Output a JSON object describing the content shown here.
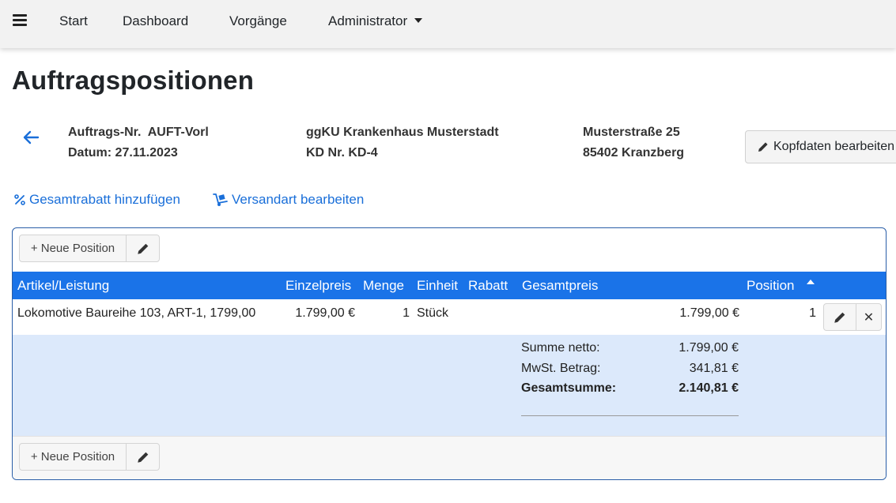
{
  "nav": {
    "items": [
      "Start",
      "Dashboard",
      "Vorgänge"
    ],
    "admin_label": "Administrator"
  },
  "page": {
    "title": "Auftragspositionen"
  },
  "header": {
    "order_no": "Auftrags-Nr.  AUFT-Vorl",
    "date": "Datum: 27.11.2023",
    "customer_name": "ggKU Krankenhaus Musterstadt",
    "customer_no": "KD Nr. KD-4",
    "street": "Musterstraße 25",
    "city": "85402 Kranzberg",
    "edit_button": "Kopfdaten bearbeiten"
  },
  "actions": {
    "discount": "Gesamtrabatt hinzufügen",
    "shipping": "Versandart bearbeiten"
  },
  "toolbar": {
    "new_position": "+ Neue Position"
  },
  "table": {
    "columns": {
      "article": "Artikel/Leistung",
      "unit_price": "Einzelpreis",
      "quantity": "Menge",
      "unit": "Einheit",
      "discount": "Rabatt",
      "total": "Gesamtpreis",
      "position": "Position"
    },
    "rows": [
      {
        "article": "Lokomotive Baureihe 103, ART-1, 1799,00",
        "unit_price": "1.799,00 €",
        "quantity": "1",
        "unit": "Stück",
        "discount": "",
        "total": "1.799,00 €",
        "position": "1"
      }
    ]
  },
  "summary": {
    "net_label": "Summe netto:",
    "net_value": "1.799,00 €",
    "vat_label": "MwSt. Betrag:",
    "vat_value": "341,81 €",
    "gross_label": "Gesamtsumme:",
    "gross_value": "2.140,81 €"
  },
  "colors": {
    "header_bg": "#1a73e8",
    "summary_bg": "#dce9fb",
    "link": "#1a6fd9",
    "card_border": "#2a5ea8"
  }
}
